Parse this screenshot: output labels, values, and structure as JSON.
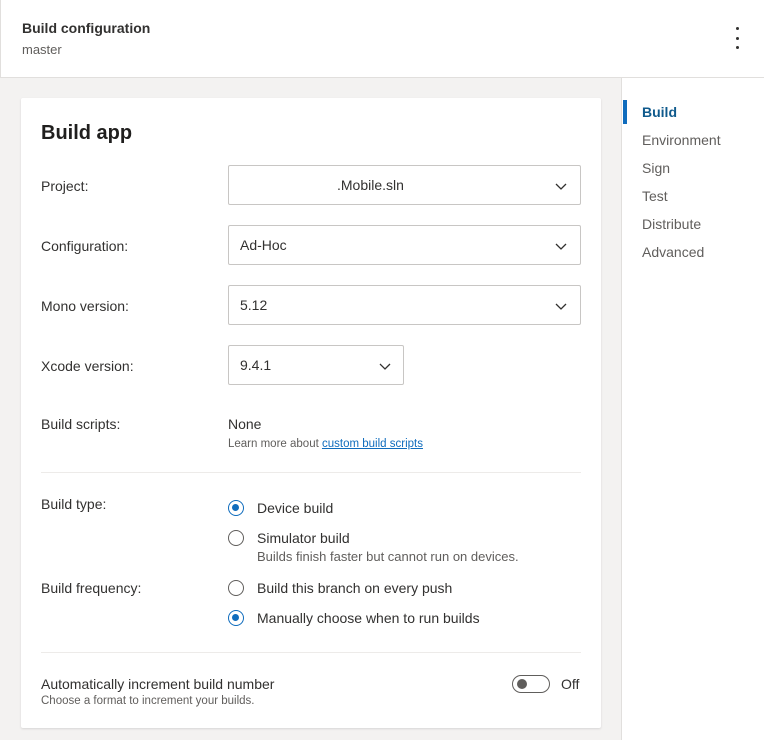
{
  "header": {
    "title": "Build configuration",
    "subtitle": "master"
  },
  "card": {
    "title": "Build app",
    "project": {
      "label": "Project:",
      "value": ".Mobile.sln"
    },
    "configuration": {
      "label": "Configuration:",
      "value": "Ad-Hoc"
    },
    "mono": {
      "label": "Mono version:",
      "value": "5.12"
    },
    "xcode": {
      "label": "Xcode version:",
      "value": "9.4.1"
    },
    "scripts": {
      "label": "Build scripts:",
      "value": "None",
      "learn_prefix": "Learn more about ",
      "learn_link": "custom build scripts"
    },
    "build_type": {
      "label": "Build type:",
      "options": [
        {
          "label": "Device build",
          "selected": true
        },
        {
          "label": "Simulator build",
          "selected": false,
          "description": "Builds finish faster but cannot run on devices."
        }
      ]
    },
    "build_frequency": {
      "label": "Build frequency:",
      "options": [
        {
          "label": "Build this branch on every push",
          "selected": false
        },
        {
          "label": "Manually choose when to run builds",
          "selected": true
        }
      ]
    },
    "auto_increment": {
      "title": "Automatically increment build number",
      "description": "Choose a format to increment your builds.",
      "state": "Off"
    }
  },
  "sidebar": {
    "items": [
      {
        "label": "Build",
        "active": true
      },
      {
        "label": "Environment",
        "active": false
      },
      {
        "label": "Sign",
        "active": false
      },
      {
        "label": "Test",
        "active": false
      },
      {
        "label": "Distribute",
        "active": false
      },
      {
        "label": "Advanced",
        "active": false
      }
    ]
  },
  "colors": {
    "accent": "#0f6cbd",
    "nav_active": "#0f5a8c"
  }
}
